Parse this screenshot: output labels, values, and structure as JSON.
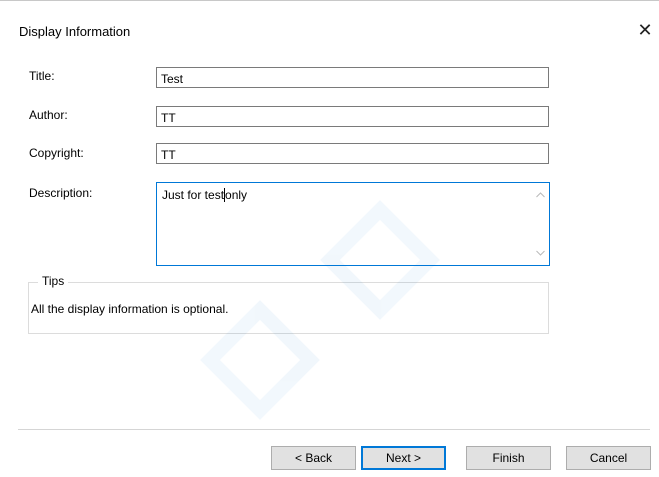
{
  "window": {
    "title": "Display Information",
    "close_glyph": "✕"
  },
  "form": {
    "title_label": "Title:",
    "title_value": "Test",
    "author_label": "Author:",
    "author_value": "TT",
    "copyright_label": "Copyright:",
    "copyright_value": "TT",
    "description_label": "Description:",
    "description_before_caret": "Just for test",
    "description_after_caret": "only"
  },
  "tips": {
    "legend": "Tips",
    "text": "All the display information is optional."
  },
  "buttons": {
    "back": "< Back",
    "next": "Next >",
    "finish": "Finish",
    "cancel": "Cancel"
  },
  "colors": {
    "focus_border": "#0078d7",
    "button_face": "#e1e1e1"
  },
  "icons": [
    "close-icon",
    "scroll-up-arrow-icon",
    "scroll-down-arrow-icon"
  ]
}
